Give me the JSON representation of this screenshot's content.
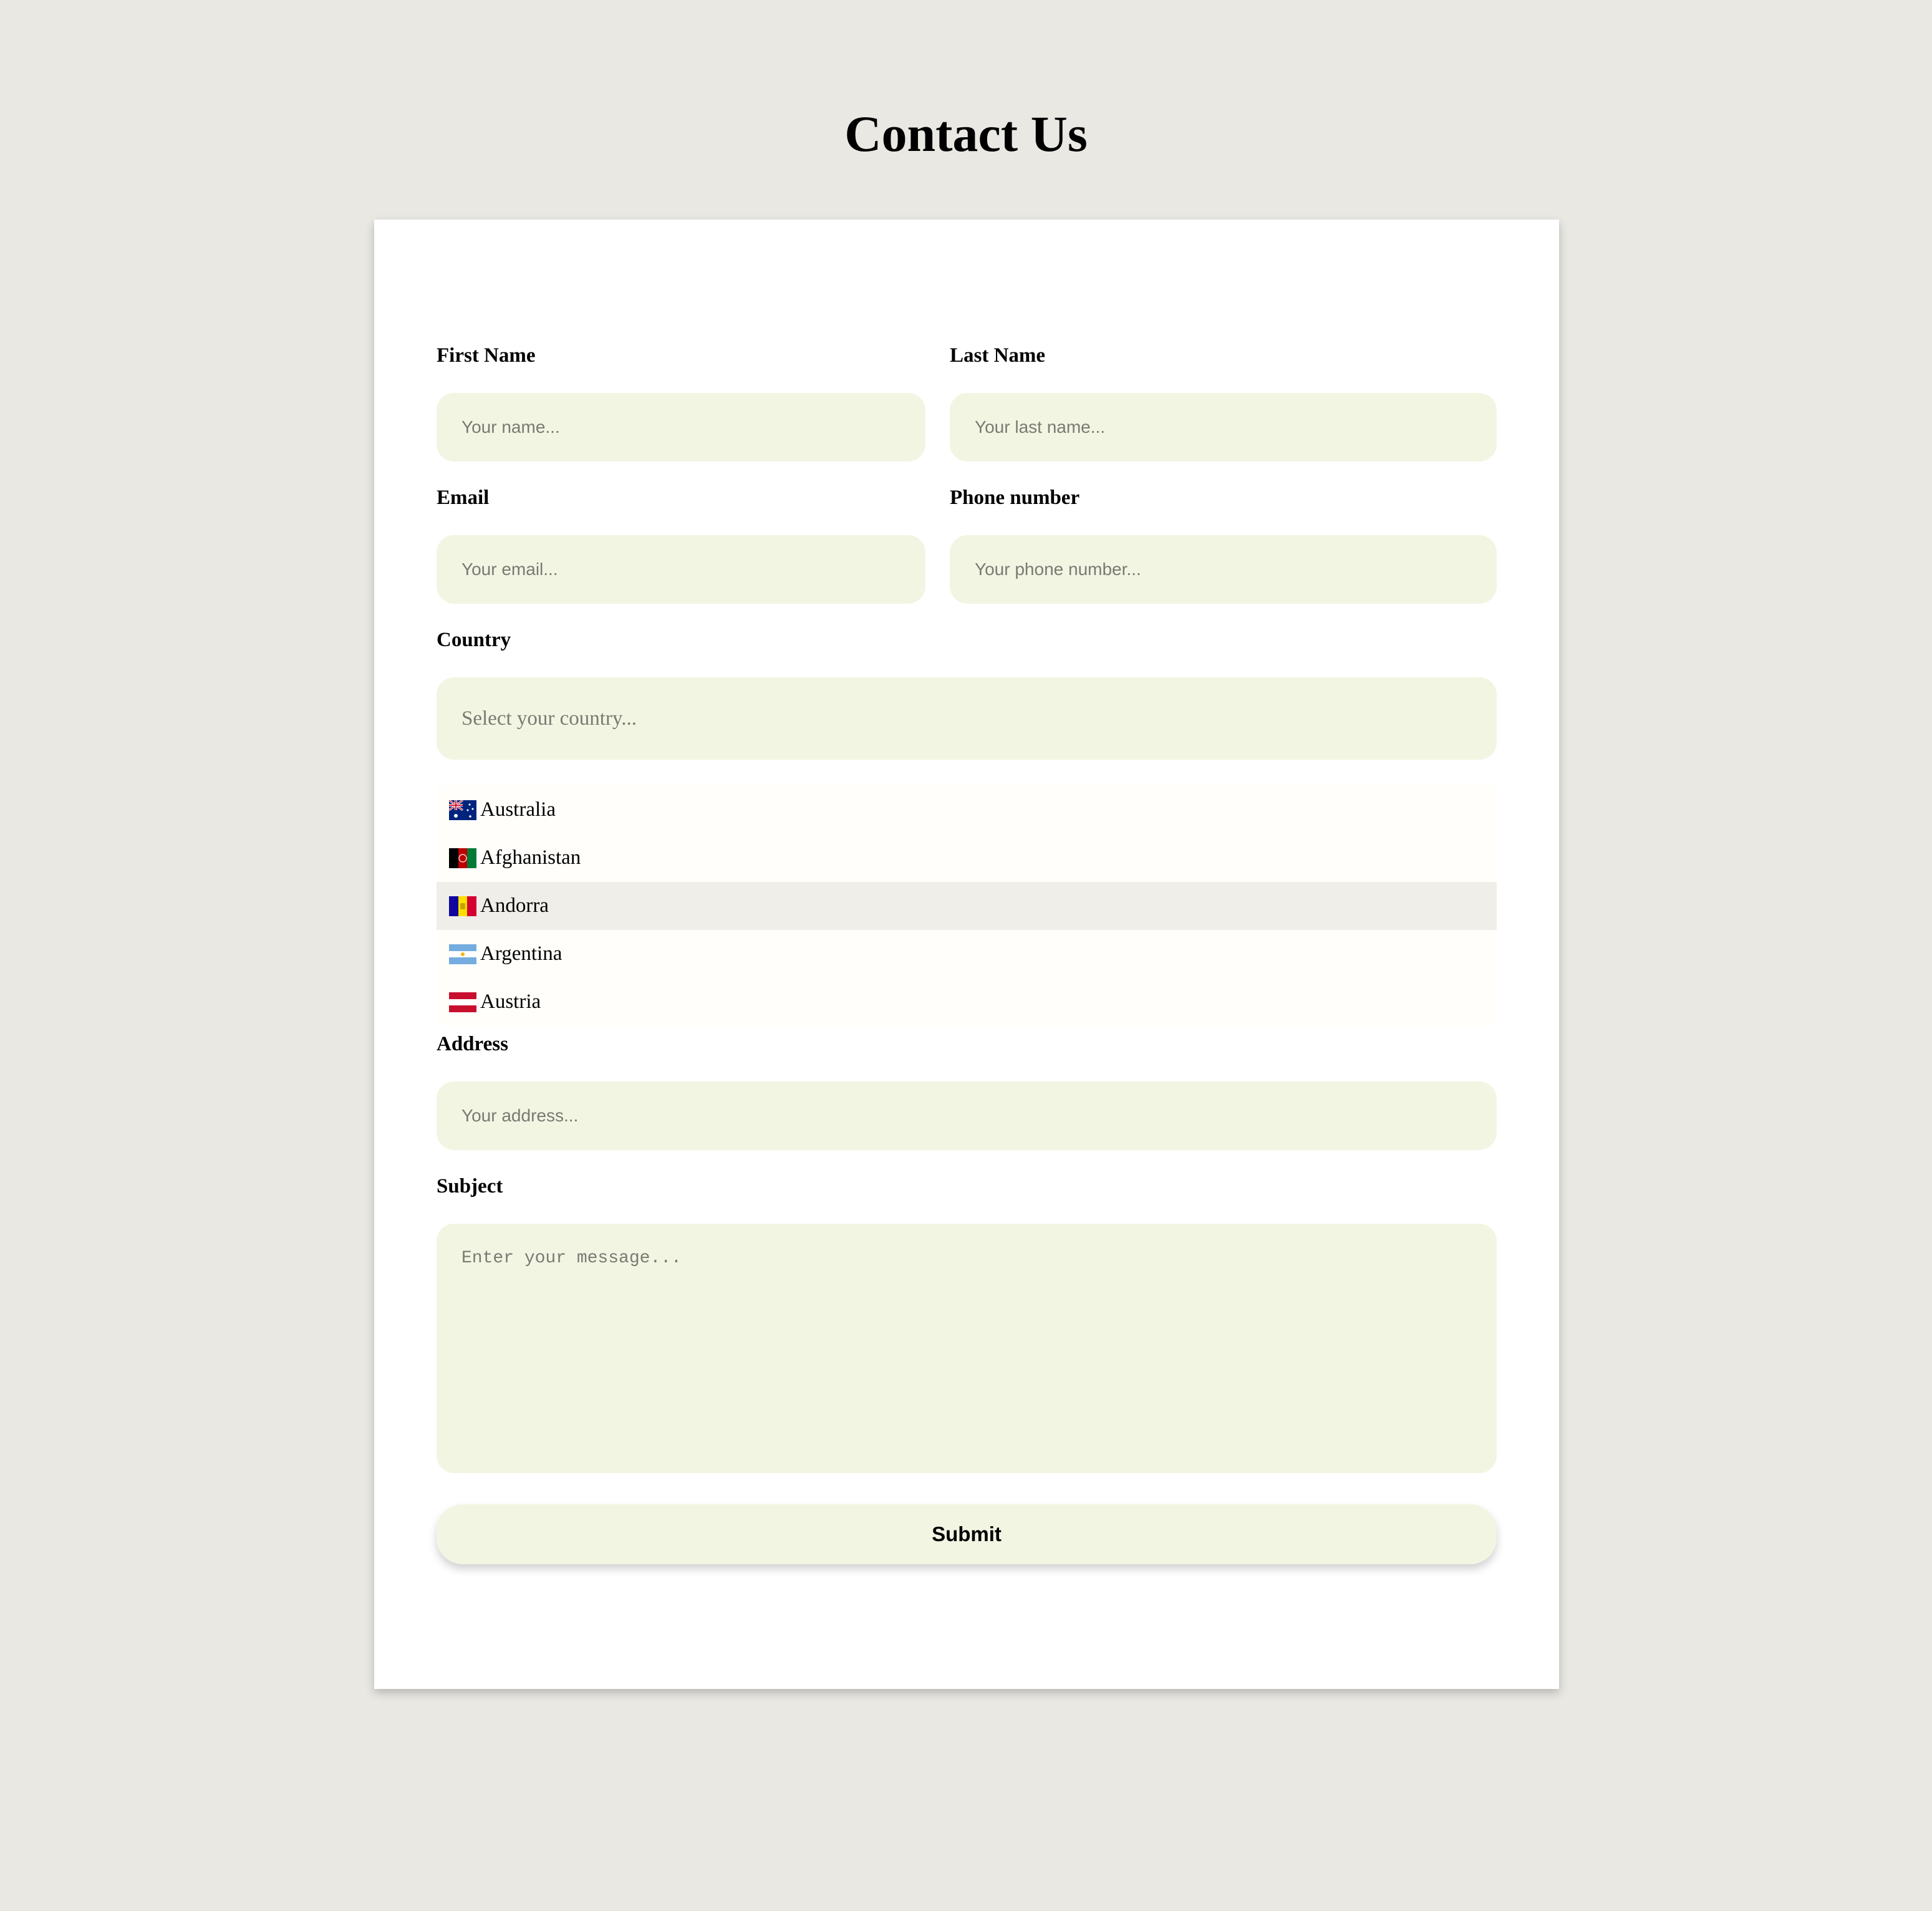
{
  "page": {
    "title": "Contact Us"
  },
  "form": {
    "first_name": {
      "label": "First Name",
      "placeholder": "Your name...",
      "value": ""
    },
    "last_name": {
      "label": "Last Name",
      "placeholder": "Your last name...",
      "value": ""
    },
    "email": {
      "label": "Email",
      "placeholder": "Your email...",
      "value": ""
    },
    "phone": {
      "label": "Phone number",
      "placeholder": "Your phone number...",
      "value": ""
    },
    "country": {
      "label": "Country",
      "placeholder": "Select your country...",
      "value": "",
      "options": [
        {
          "name": "Australia",
          "flag": "flag-australia-icon"
        },
        {
          "name": "Afghanistan",
          "flag": "flag-afghanistan-icon"
        },
        {
          "name": "Andorra",
          "flag": "flag-andorra-icon"
        },
        {
          "name": "Argentina",
          "flag": "flag-argentina-icon"
        },
        {
          "name": "Austria",
          "flag": "flag-austria-icon"
        }
      ],
      "hovered_option": "Andorra"
    },
    "address": {
      "label": "Address",
      "placeholder": "Your address...",
      "value": ""
    },
    "subject": {
      "label": "Subject",
      "placeholder": "Enter your message...",
      "value": ""
    },
    "submit_label": "Submit"
  },
  "colors": {
    "background": "#e9e8e3",
    "card": "#ffffff",
    "field": "#f2f5e2",
    "dropdown": "#fffefa",
    "option_hover": "#f0eee9"
  }
}
